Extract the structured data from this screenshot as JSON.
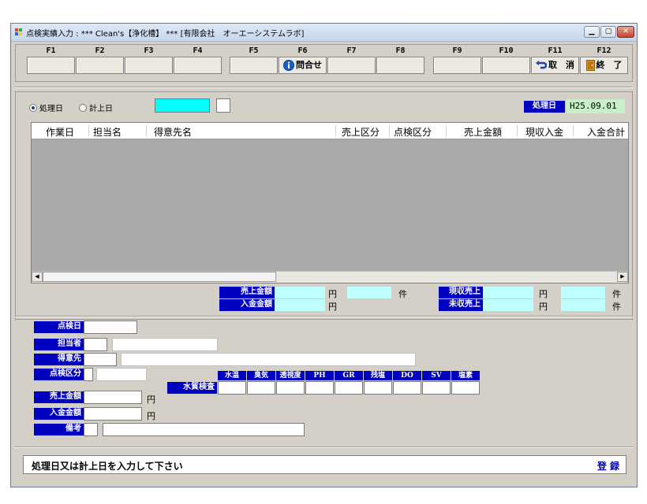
{
  "window": {
    "title": "点検実績入力 :  *** Clean's【浄化槽】 *** [有限会社　オーエーシステムラボ]",
    "minimize": "▁",
    "maximize": "▢",
    "close": "✕"
  },
  "fkeys": [
    {
      "key": "F1",
      "label": ""
    },
    {
      "key": "F2",
      "label": ""
    },
    {
      "key": "F3",
      "label": ""
    },
    {
      "key": "F4",
      "label": ""
    },
    {
      "key": "F5",
      "label": ""
    },
    {
      "key": "F6",
      "label": "問合せ",
      "icon": "info-icon"
    },
    {
      "key": "F7",
      "label": ""
    },
    {
      "key": "F8",
      "label": ""
    },
    {
      "key": "F9",
      "label": ""
    },
    {
      "key": "F10",
      "label": ""
    },
    {
      "key": "F11",
      "label": "取　消",
      "icon": "undo-arrow-icon"
    },
    {
      "key": "F12",
      "label": "終　了",
      "icon": "exit-door-icon"
    }
  ],
  "filter": {
    "radio_processing_date": "処理日",
    "radio_posting_date": "計上日",
    "selected": "処理日",
    "date_value": "",
    "date_suffix_value": ""
  },
  "processing_date": {
    "label": "処理日",
    "value": "H25.09.01"
  },
  "grid": {
    "columns": [
      "作業日",
      "担当名",
      "得意先名",
      "売上区分",
      "点検区分",
      "売上金額",
      "現収入金",
      "入金合計"
    ],
    "rows": []
  },
  "summary": {
    "sales_amount_label": "売上金額",
    "payment_amount_label": "入金金額",
    "current_sales_label": "現収売上",
    "uncollected_sales_label": "未収売上",
    "yen": "円",
    "count_unit": "件"
  },
  "form": {
    "inspection_date_label": "点検日",
    "staff_label": "担当者",
    "customer_label": "得意先",
    "inspection_type_label": "点検区分",
    "water_quality_label": "水質検査",
    "water_quality_columns": [
      "水温",
      "臭気",
      "透視度",
      "PH",
      "GR",
      "残塩",
      "DO",
      "SV",
      "塩素"
    ],
    "sales_amount_label": "売上金額",
    "payment_amount_label": "入金金額",
    "remarks_label": "備考",
    "yen": "円"
  },
  "status": {
    "message": "処理日又は計上日を入力して下さい",
    "register": "登 録"
  },
  "colors": {
    "label_bg": "#0000c0",
    "cyan_field": "#00ffff",
    "light_cyan_field": "#c0ffff",
    "date_value_bg": "#c8f0c8",
    "grid_bg": "#a9a9a9"
  }
}
